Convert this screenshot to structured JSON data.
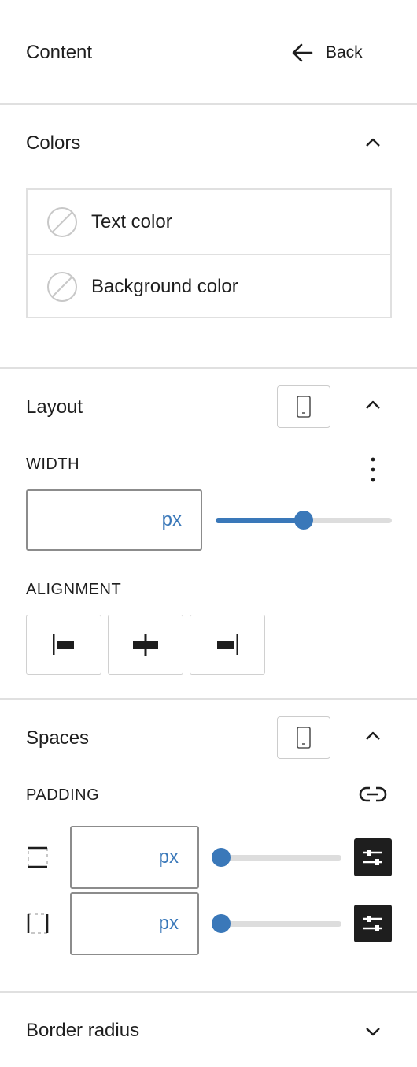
{
  "header": {
    "title": "Content",
    "back_label": "Back"
  },
  "colors": {
    "title": "Colors",
    "items": [
      {
        "label": "Text color"
      },
      {
        "label": "Background color"
      }
    ]
  },
  "layout": {
    "title": "Layout",
    "width": {
      "label": "WIDTH",
      "value": "",
      "unit": "px",
      "slider_fraction": 0.5
    },
    "alignment": {
      "label": "ALIGNMENT",
      "options": [
        "align-left",
        "align-center",
        "align-right"
      ]
    }
  },
  "spaces": {
    "title": "Spaces",
    "padding": {
      "label": "PADDING",
      "rows": [
        {
          "icon": "padding-vertical-icon",
          "value": "",
          "unit": "px",
          "slider_fraction": 0
        },
        {
          "icon": "padding-horizontal-icon",
          "value": "",
          "unit": "px",
          "slider_fraction": 0
        }
      ]
    }
  },
  "border_radius": {
    "title": "Border radius"
  },
  "colors_theme": {
    "accent": "#3a78b9",
    "text": "#1e1e1e",
    "border": "#e0e0e0"
  }
}
